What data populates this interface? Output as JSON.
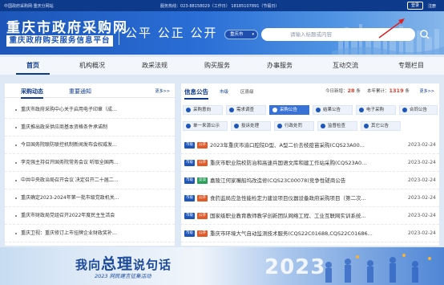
{
  "topbar": {
    "left_text": "中国政府采购网·重庆分网站",
    "center_text": "服务热线：023-88158029（工作日） 18185107891（节假日）",
    "login": "登录",
    "register": "注册"
  },
  "header": {
    "title": "重庆市政府采购网",
    "subtitle": "重庆政府购买服务信息平台",
    "slogan": "公平 公正 公开",
    "region_select": "重庆市",
    "search_placeholder": "请输入标题或内容"
  },
  "nav": [
    "首页",
    "机构概况",
    "政采法规",
    "购买服务",
    "办事服务",
    "互动交流",
    "专题栏目"
  ],
  "left": {
    "tabs": [
      "采购动态",
      "重要通知"
    ],
    "more": "更多>>",
    "news": [
      "重庆市政府采购中心关于启用电子印章（成...",
      "重庆推出政采供应商基本资格条件承诺制",
      "今日国务院联防联控机制新闻发布会权威发...",
      "李克强主持召开国务院常务会议 听取全国两...",
      "中共中央政治局召开会议 决定召开二十届二...",
      "重庆确定2023-2024年第一批市级党政机关...",
      "重庆市财政局党组召开2022年度民主生活会",
      "重庆卫视：重庆修订上市挂牌企业财政奖补..."
    ]
  },
  "right": {
    "title": "信息公告",
    "sub_tabs": [
      "市级",
      "区县级"
    ],
    "stat_today_label": "今日新增：",
    "stat_today": "28",
    "stat_year_label": "本年累计：",
    "stat_year": "1319",
    "stat_unit": "条",
    "more": "更多>>",
    "categories": [
      "采购意向",
      "需求调查",
      "采购公告",
      "结果公告",
      "电子采购",
      "合同公告",
      "单一来源公示",
      "投诉处理",
      "行政处罚",
      "监督检查",
      "其它公告"
    ],
    "notices": [
      {
        "level": "市级",
        "type": "公开",
        "title": "2023年重庆市渝口腔院D型、A型二价去枝疫苗采购(CQS23A00...",
        "date": "2023-02-24"
      },
      {
        "level": "市级",
        "type": "公开",
        "title": "重庆市职业院校防治和高速兵国语文库和建工作站采购(CQS23A0...",
        "date": "2023-02-24"
      },
      {
        "level": "市级",
        "type": "竞谈",
        "title": "嘉陵江何家嘴船坞改造修(CQS23C00078)竞争性磋商公告",
        "date": "2023-02-24"
      },
      {
        "level": "市级",
        "type": "公开",
        "title": "食药监局应急性能检定力建设项目仪器设备政府采购项目（第二次...",
        "date": "2023-02-24"
      },
      {
        "level": "市级",
        "type": "公开",
        "title": "国家级职业教育教师教学创新团队网络工程、工业互联网实训系统...",
        "date": "2023-02-24"
      },
      {
        "level": "市级",
        "type": "公开",
        "title": "重庆市环境大气自动监测技术服务(CQS22C01688,CQS22C01686...",
        "date": "2023-02-24"
      }
    ]
  },
  "banner": {
    "title_pre": "我向",
    "title_big": "总理",
    "title_post": "说句话",
    "subtitle": "2023 网民建言征集活动",
    "year": "2023"
  }
}
